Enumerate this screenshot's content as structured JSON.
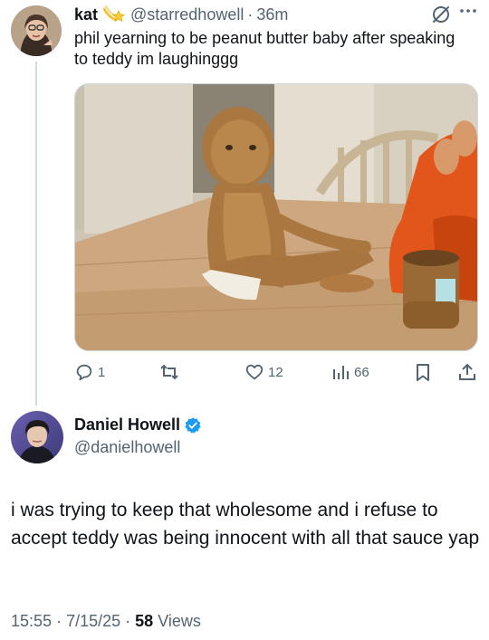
{
  "reply_tweet": {
    "author_name": "kat",
    "handle": "@starredhowell",
    "separator": "·",
    "time_ago": "36m",
    "text": "phil yearning to be peanut butter baby after speaking to teddy im laughinggg",
    "media_icon": "peanut-butter-baby-photo",
    "actions": {
      "replies": "1",
      "retweets": "",
      "likes": "12",
      "views": "66"
    }
  },
  "main_tweet": {
    "author_name": "Daniel Howell",
    "verified": true,
    "handle": "@danielhowell",
    "text": "i was trying to keep that wholesome and i refuse to accept teddy was being innocent with all that sauce yap",
    "time": "15:55",
    "separator": "·",
    "date": "7/15/25",
    "views_count": "58",
    "views_label": "Views"
  },
  "colors": {
    "text": "#0f1419",
    "secondary": "#536471",
    "verified": "#1d9bf0",
    "divider": "#cfd9de"
  }
}
